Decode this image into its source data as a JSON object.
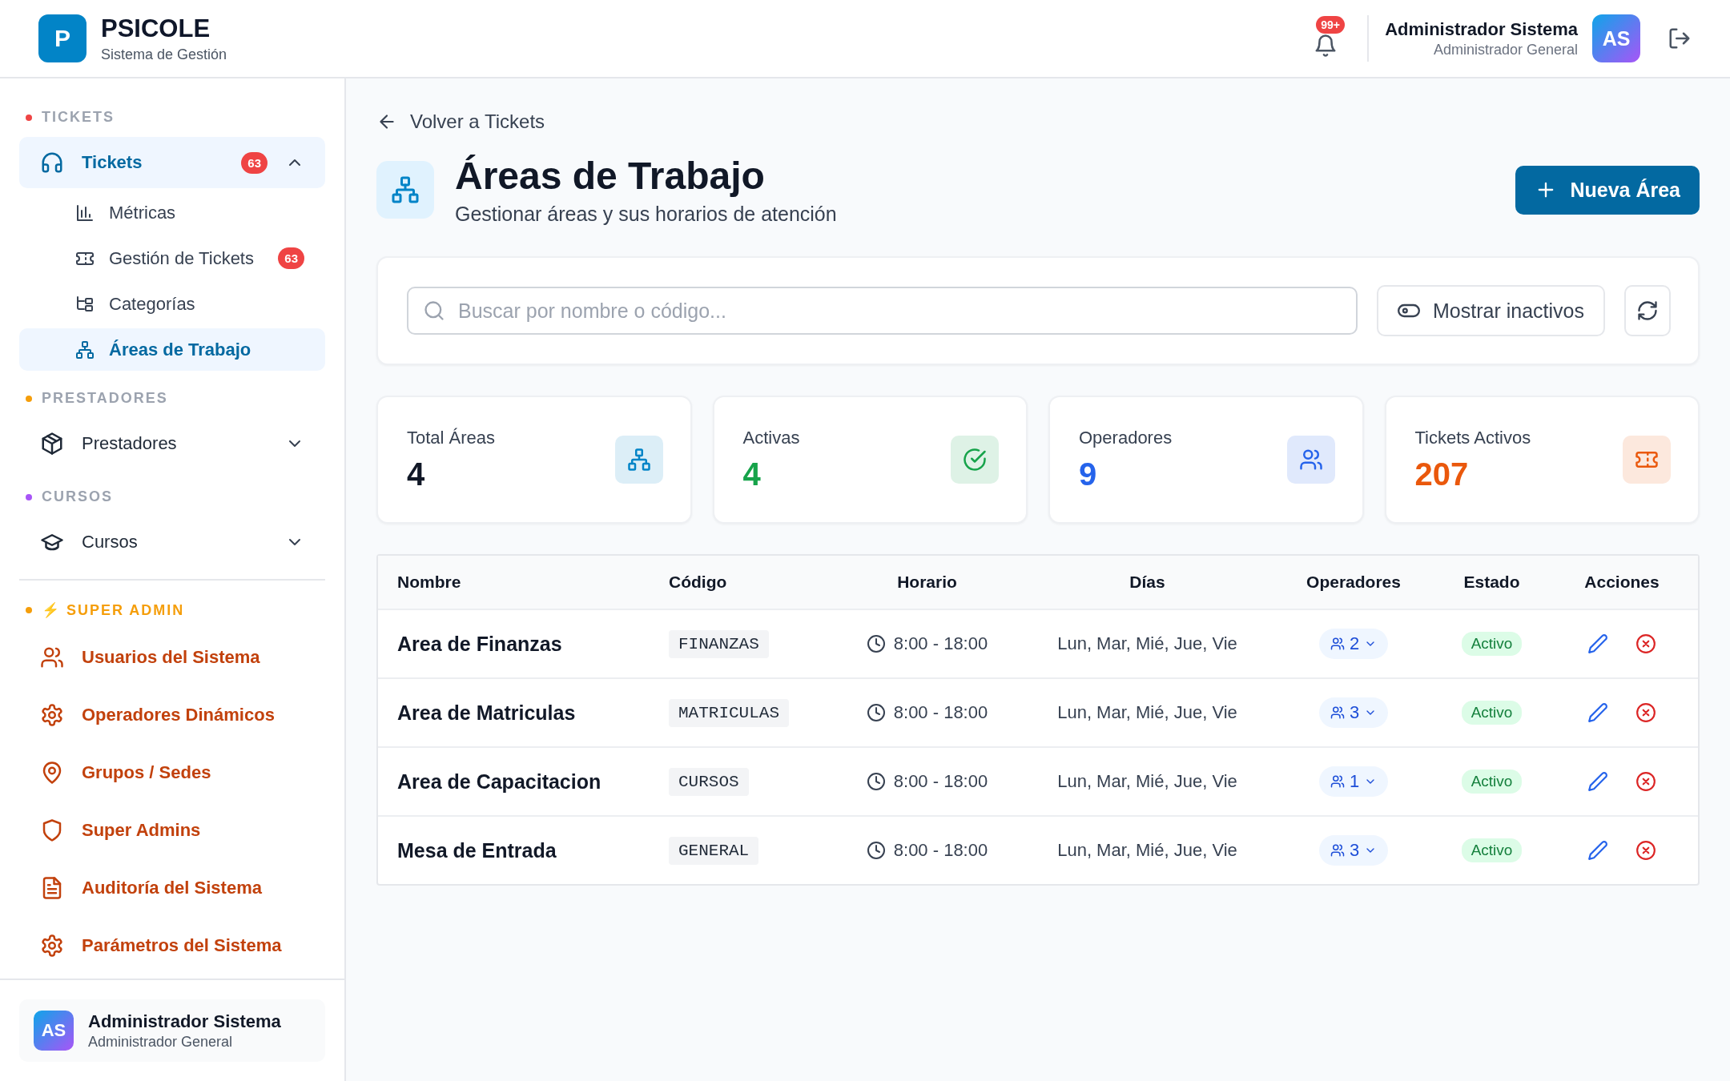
{
  "brand": {
    "logo": "P",
    "name": "PSICOLE",
    "subtitle": "Sistema de Gestión"
  },
  "topbar": {
    "notifications": "99+",
    "user_name": "Administrador Sistema",
    "user_role": "Administrador General",
    "avatar": "AS"
  },
  "sidebar": {
    "sections": [
      {
        "title": "TICKETS",
        "color": "#ef4444",
        "kind": "normal",
        "items": [
          {
            "label": "Tickets",
            "badge": "63",
            "selected": true,
            "expanded": true,
            "children": [
              {
                "label": "Métricas",
                "selected": false
              },
              {
                "label": "Gestión de Tickets",
                "badge": "63",
                "selected": false
              },
              {
                "label": "Categorías",
                "selected": false
              },
              {
                "label": "Áreas de Trabajo",
                "selected": true
              }
            ]
          }
        ]
      },
      {
        "title": "PRESTADORES",
        "color": "#f59e0b",
        "kind": "normal",
        "items": [
          {
            "label": "Prestadores",
            "selected": false,
            "expanded": false
          }
        ]
      },
      {
        "title": "CURSOS",
        "color": "#a855f7",
        "kind": "normal",
        "items": [
          {
            "label": "Cursos",
            "selected": false,
            "expanded": false
          }
        ]
      },
      {
        "title": "⚡ SUPER ADMIN",
        "color": "#f59e0b",
        "kind": "admin",
        "items": [
          {
            "label": "Usuarios del Sistema",
            "selected": false
          },
          {
            "label": "Operadores Dinámicos",
            "selected": false
          },
          {
            "label": "Grupos / Sedes",
            "selected": false
          },
          {
            "label": "Super Admins",
            "selected": false
          },
          {
            "label": "Auditoría del Sistema",
            "selected": false
          },
          {
            "label": "Parámetros del Sistema",
            "selected": false
          }
        ]
      }
    ],
    "user": {
      "avatar": "AS",
      "name": "Administrador Sistema",
      "role": "Administrador General"
    }
  },
  "page": {
    "back": "Volver a Tickets",
    "title": "Áreas de Trabajo",
    "subtitle": "Gestionar áreas y sus horarios de atención",
    "new_button": "Nueva Área"
  },
  "filters": {
    "search": {
      "placeholder": "Buscar por nombre o código..."
    },
    "toggle": "Mostrar inactivos"
  },
  "stats": [
    {
      "label": "Total Áreas",
      "value": "4",
      "color": "#0284c7",
      "kind": "plain"
    },
    {
      "label": "Activas",
      "value": "4",
      "color": "#16a34a",
      "kind": "accent"
    },
    {
      "label": "Operadores",
      "value": "9",
      "color": "#2563eb",
      "kind": "accent"
    },
    {
      "label": "Tickets Activos",
      "value": "207",
      "color": "#ea580c",
      "kind": "accent"
    }
  ],
  "table": {
    "columns": [
      "Nombre",
      "Código",
      "Horario",
      "Días",
      "Operadores",
      "Estado",
      "Acciones"
    ],
    "rows": [
      {
        "name": "Area de Finanzas",
        "code": "FINANZAS",
        "hours": "8:00 - 18:00",
        "days": "Lun, Mar, Mié, Jue, Vie",
        "operators": "2",
        "status": "Activo"
      },
      {
        "name": "Area de Matriculas",
        "code": "MATRICULAS",
        "hours": "8:00 - 18:00",
        "days": "Lun, Mar, Mié, Jue, Vie",
        "operators": "3",
        "status": "Activo"
      },
      {
        "name": "Area de Capacitacion",
        "code": "CURSOS",
        "hours": "8:00 - 18:00",
        "days": "Lun, Mar, Mié, Jue, Vie",
        "operators": "1",
        "status": "Activo"
      },
      {
        "name": "Mesa de Entrada",
        "code": "GENERAL",
        "hours": "8:00 - 18:00",
        "days": "Lun, Mar, Mié, Jue, Vie",
        "operators": "3",
        "status": "Activo"
      }
    ]
  }
}
